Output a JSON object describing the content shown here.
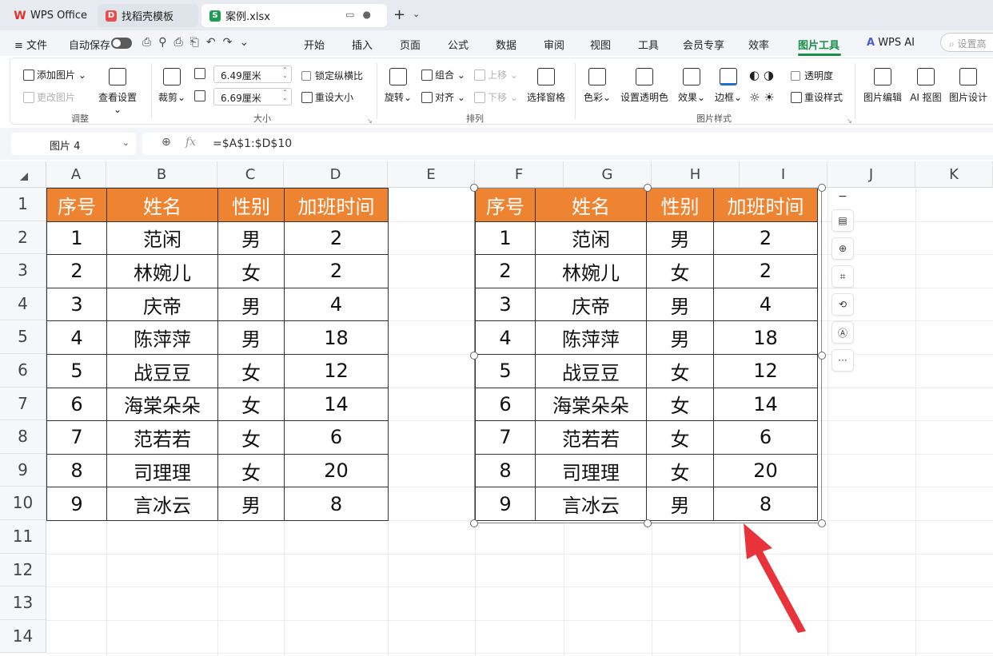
{
  "tabs": [
    {
      "label": "WPS Office",
      "icon": "wps-logo-icon"
    },
    {
      "label": "找稻壳模板",
      "icon": "docer-icon"
    },
    {
      "label": "案例.xlsx",
      "icon": "spreadsheet-icon"
    }
  ],
  "menu": {
    "file": "文件",
    "autosave": "自动保存",
    "items": [
      "开始",
      "插入",
      "页面",
      "公式",
      "数据",
      "审阅",
      "视图",
      "工具",
      "会员专享",
      "效率",
      "图片工具",
      "WPS AI"
    ],
    "active": "图片工具",
    "search_placeholder": "设置高"
  },
  "ribbon": {
    "add_picture": "添加图片",
    "change_picture": "更改图片",
    "view_settings": "查看设置",
    "group_adjust": "调整",
    "crop": "裁剪",
    "width_value": "6.49厘米",
    "height_value": "6.69厘米",
    "lock_ratio": "锁定纵横比",
    "reset_size": "重设大小",
    "group_size": "大小",
    "rotate": "旋转",
    "combine": "组合",
    "align": "对齐",
    "move_up": "上移",
    "move_down": "下移",
    "select_pane": "选择窗格",
    "group_arrange": "排列",
    "color": "色彩",
    "set_transparent": "设置透明色",
    "effects": "效果",
    "border": "边框",
    "transparency": "透明度",
    "reset_style": "重设样式",
    "group_style": "图片样式",
    "picture_edit": "图片编辑",
    "ai_cutout": "AI 抠图",
    "picture_design": "图片设计"
  },
  "formula_bar": {
    "name_box": "图片 4",
    "fx": "fx",
    "formula": "=$A$1:$D$10"
  },
  "columns": [
    "A",
    "B",
    "C",
    "D",
    "E",
    "F",
    "G",
    "H",
    "I",
    "J",
    "K"
  ],
  "rows": [
    "1",
    "2",
    "3",
    "4",
    "5",
    "6",
    "7",
    "8",
    "9",
    "10",
    "11",
    "12",
    "13",
    "14"
  ],
  "table": {
    "headers": [
      "序号",
      "姓名",
      "性别",
      "加班时间"
    ],
    "rows": [
      [
        "1",
        "范闲",
        "男",
        "2"
      ],
      [
        "2",
        "林婉儿",
        "女",
        "2"
      ],
      [
        "3",
        "庆帝",
        "男",
        "4"
      ],
      [
        "4",
        "陈萍萍",
        "男",
        "18"
      ],
      [
        "5",
        "战豆豆",
        "女",
        "12"
      ],
      [
        "6",
        "海棠朵朵",
        "女",
        "14"
      ],
      [
        "7",
        "范若若",
        "女",
        "6"
      ],
      [
        "8",
        "司理理",
        "女",
        "20"
      ],
      [
        "9",
        "言冰云",
        "男",
        "8"
      ]
    ],
    "header_color": "#ee8432"
  },
  "float_toolbar": [
    "minus-icon",
    "chart-icon",
    "zoom-in-icon",
    "crop-icon",
    "rotate-icon",
    "ocr-icon",
    "more-icon"
  ],
  "accent_color": "#1b8e4a",
  "arrow_color": "#e8333a"
}
